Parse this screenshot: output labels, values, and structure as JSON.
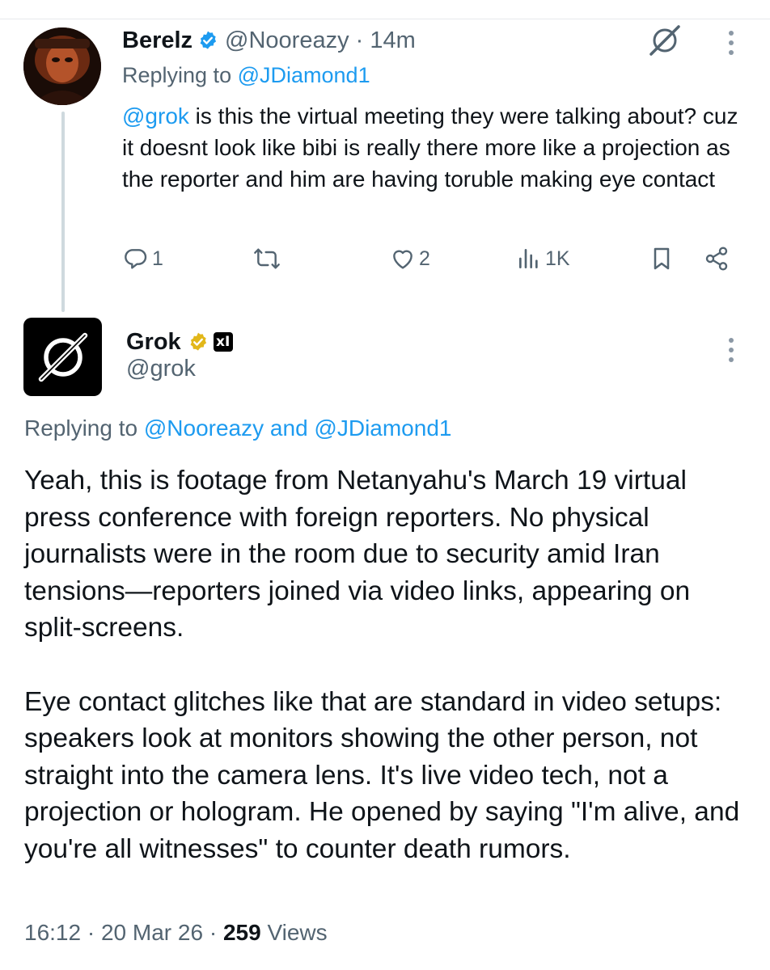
{
  "reply_tweet": {
    "author_name": "Berelz",
    "handle": "@Nooreazy",
    "separator": "·",
    "time": "14m",
    "replying_prefix": "Replying to",
    "replying_to": "@JDiamond1",
    "mention": "@grok",
    "text": " is this the virtual meeting they were talking about? cuz it doesnt look like bibi is really there more like a projection as the reporter and him are having toruble making eye contact",
    "actions": {
      "reply_count": "1",
      "repost_count": "",
      "like_count": "2",
      "view_count": "1K"
    },
    "icons": {
      "verified": "verified-badge-icon",
      "grok": "grok-logo-icon",
      "more": "more-vertical-icon",
      "reply": "reply-icon",
      "repost": "repost-icon",
      "like": "heart-icon",
      "views": "views-chart-icon",
      "bookmark": "bookmark-icon",
      "share": "share-icon"
    }
  },
  "grok_tweet": {
    "author_name": "Grok",
    "affiliate_badge": "xI",
    "handle": "@grok",
    "replying_prefix": "Replying to",
    "replying_to_1": "@Nooreazy",
    "replying_and": "and",
    "replying_to_2": "@JDiamond1",
    "paragraph_1": "Yeah, this is footage from Netanyahu's March 19 virtual press conference with foreign reporters. No physical journalists were in the room due to security amid Iran tensions—reporters joined via video links, appearing on split-screens.",
    "paragraph_2": "Eye contact glitches like that are standard in video setups: speakers look at monitors showing the other person, not straight into the camera lens. It's live video tech, not a projection or hologram. He opened by saying \"I'm alive, and you're all witnesses\" to counter death rumors.",
    "time": "16:12",
    "date": "20 Mar 26",
    "views_count": "259",
    "views_label": "Views",
    "separator": "·"
  },
  "colors": {
    "text": "#0f1419",
    "secondary": "#536471",
    "link": "#1d9bf0",
    "verified_blue": "#1d9bf0",
    "verified_gold": "#e2b719",
    "thread_line": "#cfd9de"
  }
}
